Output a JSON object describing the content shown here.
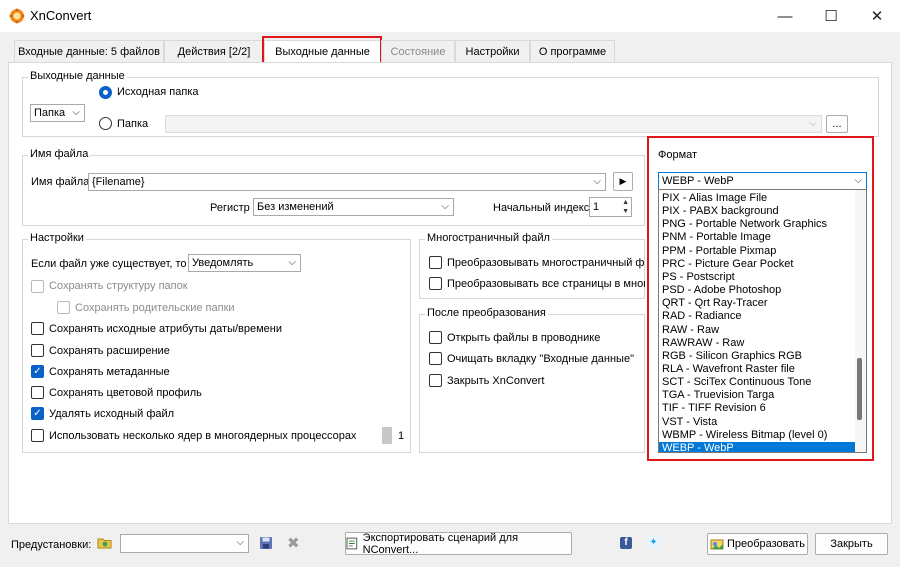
{
  "window": {
    "title": "XnConvert",
    "minimize": "—",
    "maximize": "☐",
    "close": "✕"
  },
  "tabs": [
    {
      "label": "Входные данные: 5 файлов"
    },
    {
      "label": "Действия [2/2]"
    },
    {
      "label": "Выходные данные"
    },
    {
      "label": "Состояние"
    },
    {
      "label": "Настройки"
    },
    {
      "label": "О программе"
    }
  ],
  "output": {
    "title": "Выходные данные",
    "mode_combo": "Папка",
    "radio_source_label": "Исходная папка",
    "radio_folder_label": "Папка",
    "folder_path": "",
    "browse_label": "..."
  },
  "filename": {
    "title": "Имя файла",
    "label": "Имя файла",
    "value": "{Filename}",
    "case_label": "Регистр",
    "case_value": "Без изменений",
    "start_index_label": "Начальный индекс",
    "start_index_value": "1"
  },
  "settings": {
    "title": "Настройки",
    "if_exists_label": "Если файл уже существует, то",
    "if_exists_value": "Уведомлять",
    "keep_structure": "Сохранять структуру папок",
    "keep_parents": "Сохранять родительские папки",
    "keep_date": "Сохранять исходные атрибуты даты/времени",
    "keep_ext": "Сохранять расширение",
    "keep_meta": "Сохранять метаданные",
    "keep_profile": "Сохранять цветовой профиль",
    "delete_source": "Удалять исходный файл",
    "multicore": "Использовать несколько ядер в многоядерных процессорах",
    "cores": "1"
  },
  "multipage": {
    "title": "Многостраничный файл",
    "convert_multi": "Преобразовывать многостраничный файл в",
    "convert_all": "Преобразовывать все страницы в многостр"
  },
  "after": {
    "title": "После преобразования",
    "open_explorer": "Открыть файлы в проводнике",
    "clear_input": "Очищать вкладку \"Входные данные\"",
    "close_app": "Закрыть XnConvert"
  },
  "format": {
    "title": "Формат",
    "selected": "WEBP - WebP",
    "options": [
      "PIX - Alias Image File",
      "PIX - PABX background",
      "PNG - Portable Network Graphics",
      "PNM - Portable Image",
      "PPM - Portable Pixmap",
      "PRC - Picture Gear Pocket",
      "PS - Postscript",
      "PSD - Adobe Photoshop",
      "QRT - Qrt Ray-Tracer",
      "RAD - Radiance",
      "RAW - Raw",
      "RAWRAW - Raw",
      "RGB - Silicon Graphics RGB",
      "RLA - Wavefront Raster file",
      "SCT - SciTex Continuous Tone",
      "TGA - Truevision Targa",
      "TIF - TIFF Revision 6",
      "VST - Vista",
      "WBMP - Wireless Bitmap (level 0)",
      "WEBP - WebP"
    ]
  },
  "footer": {
    "presets_label": "Предустановки:",
    "presets_value": "",
    "export_label": "Экспортировать сценарий для NConvert...",
    "convert_label": "Преобразовать",
    "close_label": "Закрыть"
  },
  "colors": {
    "accent": "#0a61c7",
    "selection": "#0078d7",
    "highlight": "#e0161b"
  }
}
